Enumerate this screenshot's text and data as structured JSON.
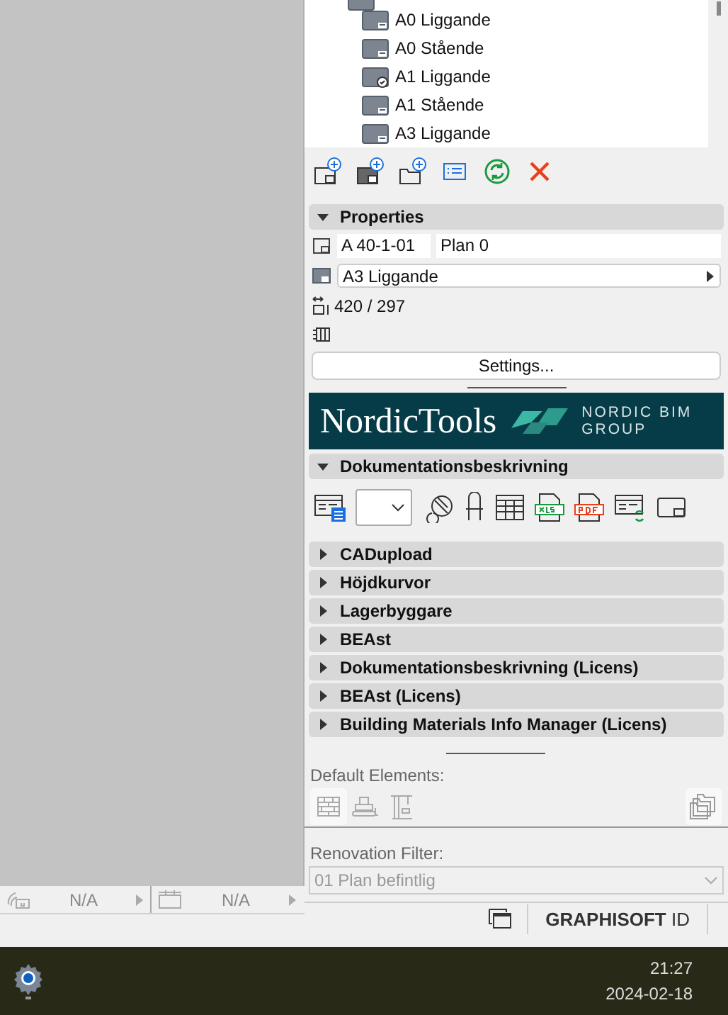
{
  "layout_tree": {
    "items": [
      {
        "label": "A0 Liggande",
        "kind": "standard"
      },
      {
        "label": "A0 Stående",
        "kind": "standard"
      },
      {
        "label": "A1 Liggande",
        "kind": "linked"
      },
      {
        "label": "A1 Stående",
        "kind": "standard"
      },
      {
        "label": "A3 Liggande",
        "kind": "standard"
      }
    ]
  },
  "properties": {
    "title": "Properties",
    "expanded": true,
    "id": "A 40-1-01",
    "name": "Plan 0",
    "master_layout": "A3 Liggande",
    "size": "420 / 297",
    "settings_button": "Settings..."
  },
  "banner": {
    "brand": "NordicTools",
    "company_line_1": "NORDIC BIM",
    "company_line_2": "GROUP"
  },
  "sections": [
    {
      "title": "Dokumentationsbeskrivning",
      "expanded": true
    },
    {
      "title": "CADupload",
      "expanded": false
    },
    {
      "title": "Höjdkurvor",
      "expanded": false
    },
    {
      "title": "Lagerbyggare",
      "expanded": false
    },
    {
      "title": "BEAst",
      "expanded": false
    },
    {
      "title": "Dokumentationsbeskrivning (Licens)",
      "expanded": false
    },
    {
      "title": "BEAst (Licens)",
      "expanded": false
    },
    {
      "title": "Building Materials Info Manager (Licens)",
      "expanded": false
    }
  ],
  "default_elements": {
    "label": "Default Elements:"
  },
  "renovation_filter": {
    "label": "Renovation Filter:",
    "value": "01 Plan befintlig",
    "disabled": true
  },
  "status_bar": {
    "items": [
      "N/A",
      "N/A"
    ],
    "account": "**GRAPHISOFT** ID"
  },
  "taskbar": {
    "time": "21:27",
    "date": "2024-02-18"
  }
}
